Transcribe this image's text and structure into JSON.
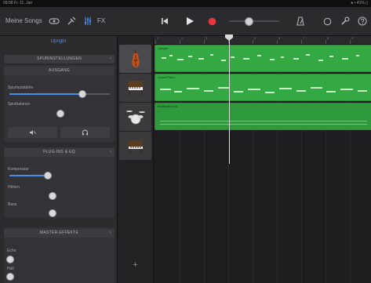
{
  "status_bar": {
    "time": "09:58 Fr. 11. Jan",
    "battery": "● • 41% ▯"
  },
  "toolbar": {
    "my_songs": "Meine Songs",
    "fx_label": "FX",
    "accent": "#4d8fe8",
    "record_color": "#e8363c"
  },
  "left_panel": {
    "title": "Upright",
    "track_settings": "SPURINSTELLUNGEN",
    "output": {
      "header": "AUSGANG",
      "volume_label": "Spurlautstärke",
      "volume_level": 0.62,
      "pan_label": "Spurbalance",
      "pan_level": 0.5
    },
    "plugins_eq": {
      "header": "PLUG-INS & EQ",
      "compressor_label": "Kompressor",
      "compressor_level": 0.35,
      "treble_label": "Höhen",
      "treble_level": 0.5,
      "bass_label": "Bass",
      "bass_level": 0.5
    },
    "master_effects": {
      "header": "MASTER-EFFEKTE",
      "echo_label": "Echo",
      "echo_level": 0.0,
      "reverb_label": "Hall",
      "reverb_level": 0.0
    }
  },
  "tracks": [
    {
      "icon": "upright-bass-icon",
      "region_name": "Upright"
    },
    {
      "icon": "piano-icon",
      "region_name": "Grand Piano"
    },
    {
      "icon": "drum-kit-icon",
      "region_name": "Beatmaker Kit"
    },
    {
      "icon": "electric-piano-icon",
      "region_name": ""
    }
  ],
  "ruler": {
    "bars": [
      "1",
      "2",
      "3",
      "4",
      "5",
      "6",
      "7",
      "8",
      "9"
    ]
  },
  "add_track": "+"
}
